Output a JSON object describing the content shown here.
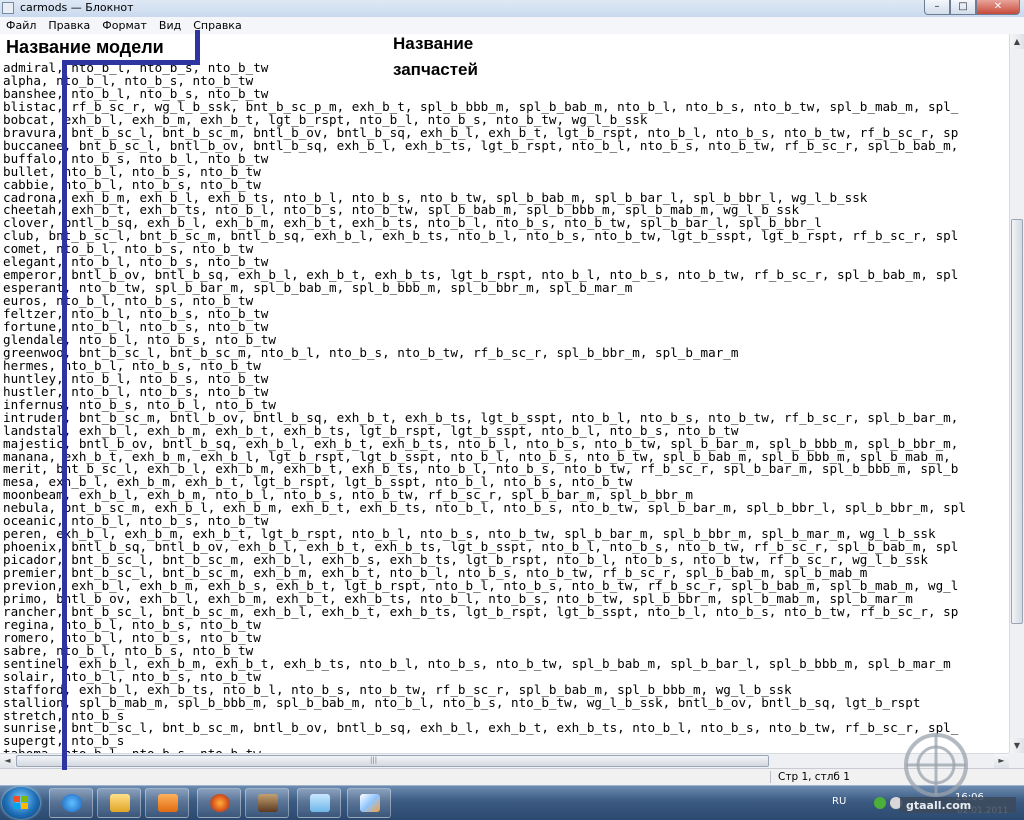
{
  "window": {
    "title": "carmods — Блокнот",
    "buttons": [
      "–",
      "□",
      "✕"
    ]
  },
  "menu": [
    "Файл",
    "Правка",
    "Формат",
    "Вид",
    "Справка"
  ],
  "annotations": {
    "model_label": "Название модели",
    "parts_label": "Название запчастей"
  },
  "lines": [
    "admiral, nto_b_l, nto_b_s, nto_b_tw",
    "alpha, nto_b_l, nto_b_s, nto_b_tw",
    "banshee, nto_b_l, nto_b_s, nto_b_tw",
    "blistac, rf_b_sc_r, wg_l_b_ssk, bnt_b_sc_p_m, exh_b_t, spl_b_bbb_m, spl_b_bab_m, nto_b_l, nto_b_s, nto_b_tw, spl_b_mab_m, spl_",
    "bobcat, exh_b_l, exh_b_m, exh_b_t, lgt_b_rspt, nto_b_l, nto_b_s, nto_b_tw, wg_l_b_ssk",
    "bravura, bnt_b_sc_l, bnt_b_sc_m, bntl_b_ov, bntl_b_sq, exh_b_l, exh_b_t, lgt_b_rspt, nto_b_l, nto_b_s, nto_b_tw, rf_b_sc_r, sp",
    "buccanee, bnt_b_sc_l, bntl_b_ov, bntl_b_sq, exh_b_l, exh_b_ts, lgt_b_rspt, nto_b_l, nto_b_s, nto_b_tw, rf_b_sc_r, spl_b_bab_m,",
    "buffalo, nto_b_s, nto_b_l, nto_b_tw",
    "bullet, nto_b_l, nto_b_s, nto_b_tw",
    "cabbie, nto_b_l, nto_b_s, nto_b_tw",
    "cadrona, exh_b_m, exh_b_l, exh_b_ts, nto_b_l, nto_b_s, nto_b_tw, spl_b_bab_m, spl_b_bar_l, spl_b_bbr_l, wg_l_b_ssk",
    "cheetah, exh_b_t, exh_b_ts, nto_b_l, nto_b_s, nto_b_tw, spl_b_bab_m, spl_b_bbb_m, spl_b_mab_m, wg_l_b_ssk",
    "clover, bntl_b_sq, exh_b_l, exh_b_m, exh_b_t, exh_b_ts, nto_b_l, nto_b_s, nto_b_tw, spl_b_bar_l, spl_b_bbr_l",
    "club, bnt_b_sc_l, bnt_b_sc_m, bntl_b_sq, exh_b_l, exh_b_ts, nto_b_l, nto_b_s, nto_b_tw, lgt_b_sspt, lgt_b_rspt, rf_b_sc_r, spl",
    "comet, nto_b_l, nto_b_s, nto_b_tw",
    "elegant, nto_b_l, nto_b_s, nto_b_tw",
    "emperor, bntl_b_ov, bntl_b_sq, exh_b_l, exh_b_t, exh_b_ts, lgt_b_rspt, nto_b_l, nto_b_s, nto_b_tw, rf_b_sc_r, spl_b_bab_m, spl",
    "esperant, nto_b_tw, spl_b_bar_m, spl_b_bab_m, spl_b_bbb_m, spl_b_bbr_m, spl_b_mar_m",
    "euros, nto_b_l, nto_b_s, nto_b_tw",
    "feltzer, nto_b_l, nto_b_s, nto_b_tw",
    "fortune, nto_b_l, nto_b_s, nto_b_tw",
    "glendale, nto_b_l, nto_b_s, nto_b_tw",
    "greenwoo, bnt_b_sc_l, bnt_b_sc_m, nto_b_l, nto_b_s, nto_b_tw, rf_b_sc_r, spl_b_bbr_m, spl_b_mar_m",
    "hermes, nto_b_l, nto_b_s, nto_b_tw",
    "huntley, nto_b_l, nto_b_s, nto_b_tw",
    "hustler, nto_b_l, nto_b_s, nto_b_tw",
    "infernus, nto_b_s, nto_b_l, nto_b_tw",
    "intruder, bnt_b_sc_m, bntl_b_ov, bntl_b_sq, exh_b_t, exh_b_ts, lgt_b_sspt, nto_b_l, nto_b_s, nto_b_tw, rf_b_sc_r, spl_b_bar_m,",
    "landstal, exh_b_l, exh_b_m, exh_b_t, exh_b_ts, lgt_b_rspt, lgt_b_sspt, nto_b_l, nto_b_s, nto_b_tw",
    "majestic, bntl_b_ov, bntl_b_sq, exh_b_l, exh_b_t, exh_b_ts, nto_b_l, nto_b_s, nto_b_tw, spl_b_bar_m, spl_b_bbb_m, spl_b_bbr_m,",
    "manana, exh_b_t, exh_b_m, exh_b_l, lgt_b_rspt, lgt_b_sspt, nto_b_l, nto_b_s, nto_b_tw, spl_b_bab_m, spl_b_bbb_m, spl_b_mab_m,",
    "merit, bnt_b_sc_l, exh_b_l, exh_b_m, exh_b_t, exh_b_ts, nto_b_l, nto_b_s, nto_b_tw, rf_b_sc_r, spl_b_bar_m, spl_b_bbb_m, spl_b",
    "mesa, exh_b_l, exh_b_m, exh_b_t, lgt_b_rspt, lgt_b_sspt, nto_b_l, nto_b_s, nto_b_tw",
    "moonbeam, exh_b_l, exh_b_m, nto_b_l, nto_b_s, nto_b_tw, rf_b_sc_r, spl_b_bar_m, spl_b_bbr_m",
    "nebula, bnt_b_sc_m, exh_b_l, exh_b_m, exh_b_t, exh_b_ts, nto_b_l, nto_b_s, nto_b_tw, spl_b_bar_m, spl_b_bbr_l, spl_b_bbr_m, spl",
    "oceanic, nto_b_l, nto_b_s, nto_b_tw",
    "peren, exh_b_l, exh_b_m, exh_b_t, lgt_b_rspt, nto_b_l, nto_b_s, nto_b_tw, spl_b_bar_m, spl_b_bbr_m, spl_b_mar_m, wg_l_b_ssk",
    "phoenix, bntl_b_sq, bntl_b_ov, exh_b_l, exh_b_t, exh_b_ts, lgt_b_sspt, nto_b_l, nto_b_s, nto_b_tw, rf_b_sc_r, spl_b_bab_m, spl",
    "picador, bnt_b_sc_l, bnt_b_sc_m, exh_b_l, exh_b_s, exh_b_ts, lgt_b_rspt, nto_b_l, nto_b_s, nto_b_tw, rf_b_sc_r, wg_l_b_ssk",
    "premier, bnt_b_sc_l, bnt_b_sc_m, exh_b_m, exh_b_t, nto_b_l, nto_b_s, nto_b_tw, rf_b_sc_r, spl_b_bab_m, spl_b_mab_m",
    "previon, exh_b_l, exh_b_m, exh_b_s, exh_b_t, lgt_b_rspt, nto_b_l, nto_b_s, nto_b_tw, rf_b_sc_r, spl_b_bab_m, spl_b_mab_m, wg_l",
    "primo, bntl_b_ov, exh_b_l, exh_b_m, exh_b_t, exh_b_ts, nto_b_l, nto_b_s, nto_b_tw, spl_b_bbr_m, spl_b_mab_m, spl_b_mar_m",
    "rancher, bnt_b_sc_l, bnt_b_sc_m, exh_b_l, exh_b_t, exh_b_ts, lgt_b_rspt, lgt_b_sspt, nto_b_l, nto_b_s, nto_b_tw, rf_b_sc_r, sp",
    "regina, nto_b_l, nto_b_s, nto_b_tw",
    "romero, nto_b_l, nto_b_s, nto_b_tw",
    "sabre, nto_b_l, nto_b_s, nto_b_tw",
    "sentinel, exh_b_l, exh_b_m, exh_b_t, exh_b_ts, nto_b_l, nto_b_s, nto_b_tw, spl_b_bab_m, spl_b_bar_l, spl_b_bbb_m, spl_b_mar_m",
    "solair, nto_b_l, nto_b_s, nto_b_tw",
    "stafford, exh_b_l, exh_b_ts, nto_b_l, nto_b_s, nto_b_tw, rf_b_sc_r, spl_b_bab_m, spl_b_bbb_m, wg_l_b_ssk",
    "stallion, spl_b_mab_m, spl_b_bbb_m, spl_b_bab_m, nto_b_l, nto_b_s, nto_b_tw, wg_l_b_ssk, bntl_b_ov, bntl_b_sq, lgt_b_rspt",
    "stretch, nto_b_s",
    "sunrise, bnt_b_sc_l, bnt_b_sc_m, bntl_b_ov, bntl_b_sq, exh_b_l, exh_b_t, exh_b_ts, nto_b_l, nto_b_s, nto_b_tw, rf_b_sc_r, spl_",
    "supergt, nto_b_s",
    "tahoma, nto_b_l, nto_b_s, nto_b_tw"
  ],
  "scrollbars": {
    "up": "▲",
    "down": "▼",
    "left": "◄",
    "right": "►",
    "grip": "|||"
  },
  "status": {
    "position": "Стр 1, стлб 1"
  },
  "taskbar": {
    "items": [
      "ie-icon",
      "explorer-icon",
      "media-player-icon",
      "firefox-icon",
      "game-icon",
      "notepad-icon",
      "paint-icon"
    ],
    "lang": "RU",
    "time": "16:06",
    "date": "02.01.2011"
  },
  "watermark": "gtaall.com",
  "colors": {
    "annotation": "#2e35a0",
    "taskbar": "#3b5a82"
  }
}
